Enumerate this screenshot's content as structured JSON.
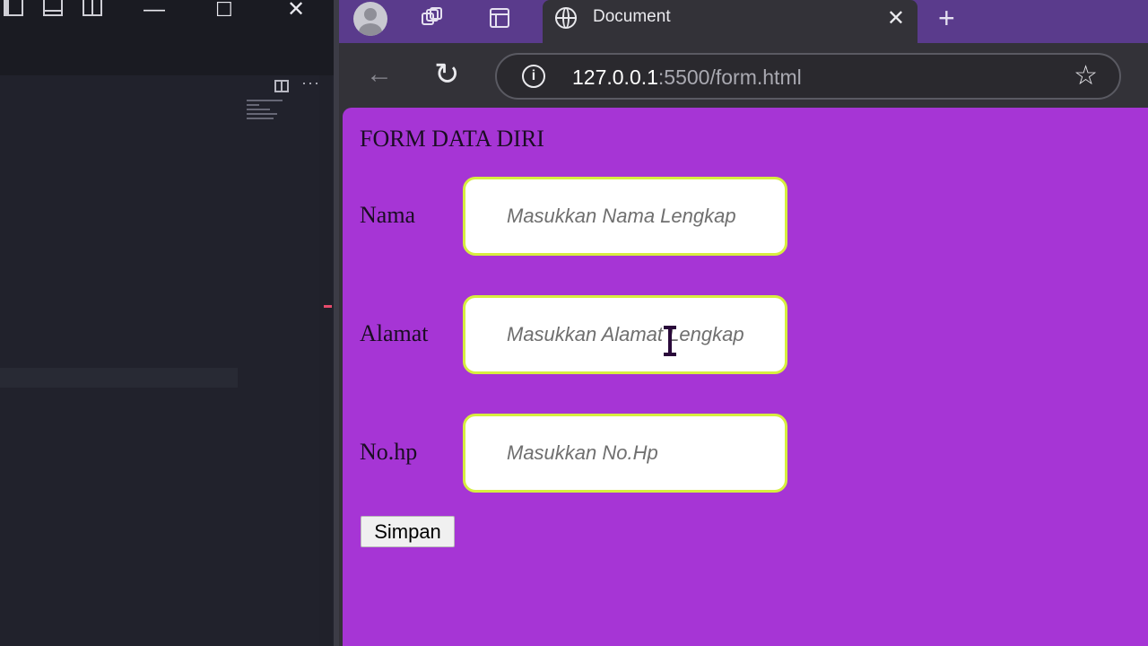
{
  "browser": {
    "tab_title": "Document",
    "url_host": "127.0.0.1",
    "url_rest": ":5500/form.html"
  },
  "form": {
    "title": "FORM DATA DIRI",
    "fields": [
      {
        "label": "Nama",
        "placeholder": "Masukkan Nama Lengkap"
      },
      {
        "label": "Alamat",
        "placeholder": "Masukkan Alamat Lengkap"
      },
      {
        "label": "No.hp",
        "placeholder": "Masukkan No.Hp"
      }
    ],
    "submit_label": "Simpan"
  },
  "colors": {
    "page_background": "#a635d5",
    "input_border": "#d7ee3f",
    "tabstrip": "#5a3b8c"
  },
  "icons": [
    "profile-icon",
    "workspaces-icon",
    "tab-actions-icon",
    "globe-icon",
    "close-icon",
    "new-tab-icon",
    "back-icon",
    "reload-icon",
    "site-info-icon",
    "favorite-star-icon",
    "text-cursor-icon"
  ]
}
